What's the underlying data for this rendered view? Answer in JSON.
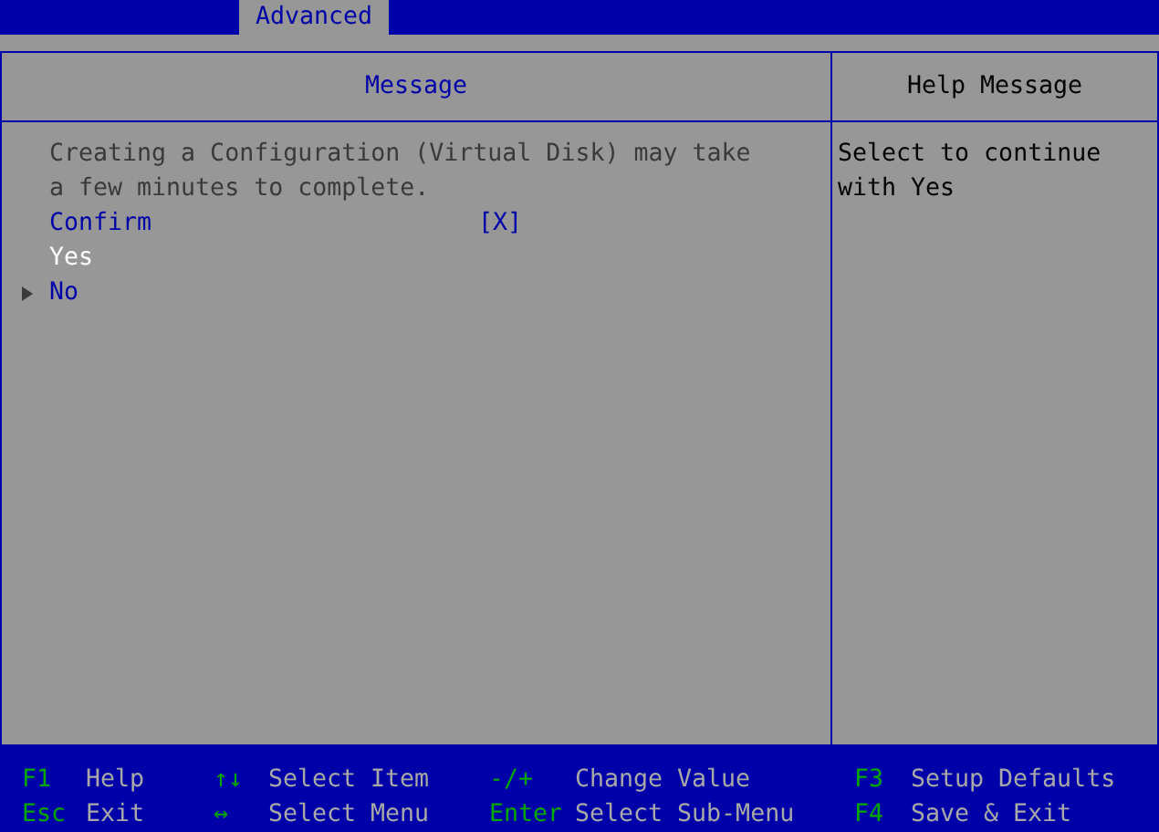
{
  "tabs": [
    {
      "label": "Advanced",
      "selected": true
    }
  ],
  "main_panel": {
    "title": "Message",
    "message": "Creating a Configuration (Virtual Disk) may take a few minutes to complete.",
    "items": [
      {
        "kind": "setting",
        "label": "Confirm",
        "value": "[X]",
        "selected": false
      },
      {
        "kind": "action",
        "label": "Yes",
        "selected": true
      },
      {
        "kind": "submenu",
        "label": "No",
        "selected": false
      }
    ]
  },
  "help_panel": {
    "title": "Help Message",
    "text": "Select to continue with Yes"
  },
  "key_legend": [
    {
      "key": "F1",
      "action": "Help"
    },
    {
      "key": "↑↓",
      "action": "Select Item"
    },
    {
      "key": "-/+",
      "action": "Change Value"
    },
    {
      "key": "F3",
      "action": "Setup Defaults"
    },
    {
      "key": "Esc",
      "action": "Exit"
    },
    {
      "key": "↔",
      "action": "Select Menu"
    },
    {
      "key": "Enter",
      "action": "Select Sub-Menu"
    },
    {
      "key": "F4",
      "action": "Save & Exit"
    }
  ]
}
